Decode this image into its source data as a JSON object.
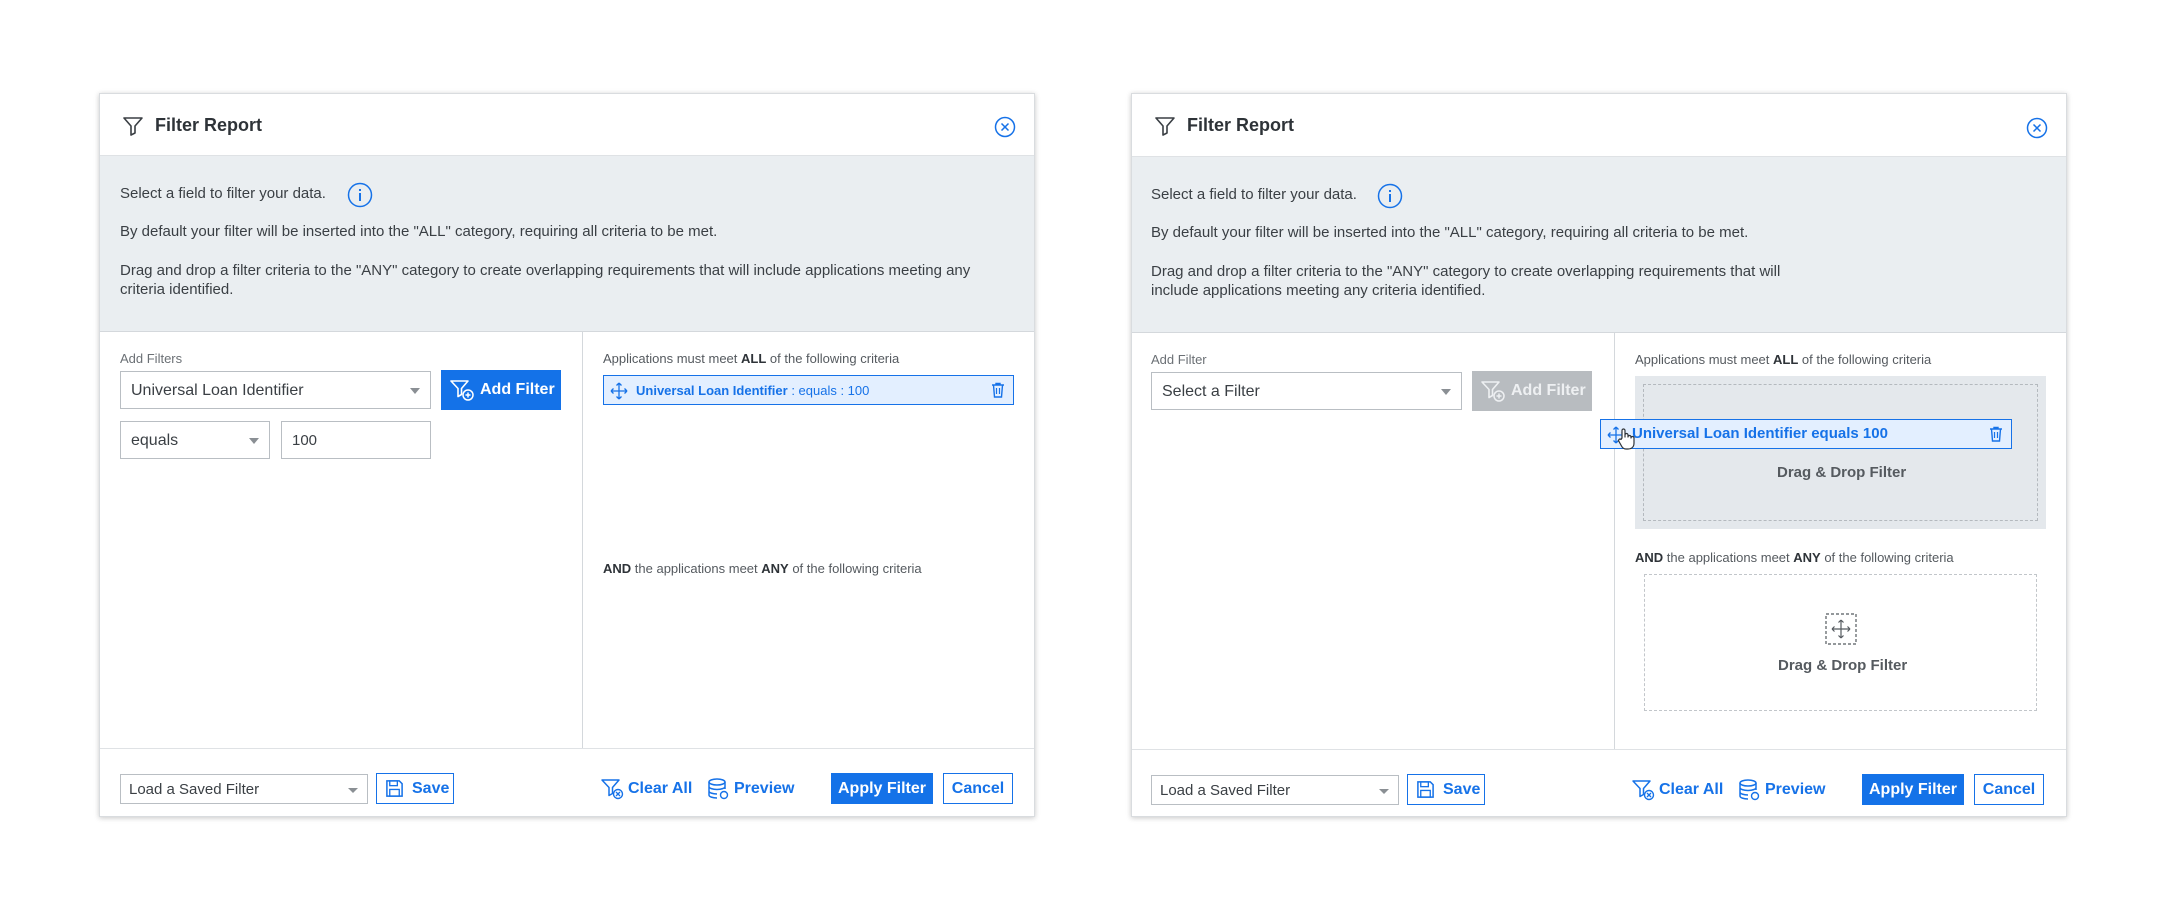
{
  "dialogs": [
    {
      "title": "Filter Report",
      "info": {
        "line1": "Select a field to filter your data.",
        "line2": "By default your filter will be inserted into the \"ALL\" category, requiring all criteria to be met.",
        "line3a": "Drag and drop a filter criteria to the \"ANY\" category to create overlapping requirements that will include applications meeting any",
        "line3b": "criteria identified."
      },
      "left": {
        "label": "Add Filters",
        "field_select": "Universal Loan Identifier",
        "add_button": "Add Filter",
        "operator_select": "equals",
        "value_input": "100"
      },
      "right": {
        "all_pre": "Applications must meet ",
        "all_bold": "ALL",
        "all_post": " of the following criteria",
        "chip_field": "Universal Loan Identifier",
        "chip_rest": " : equals : 100",
        "any_bold1": "AND",
        "any_mid": " the applications meet ",
        "any_bold2": "ANY",
        "any_post": " of the following criteria"
      },
      "footer": {
        "saved_filter": "Load a Saved Filter",
        "save": "Save",
        "clear_all": "Clear All",
        "preview": "Preview",
        "apply": "Apply Filter",
        "cancel": "Cancel"
      }
    },
    {
      "title": "Filter Report",
      "info": {
        "line1": "Select a field to filter your data.",
        "line2": "By default your filter will be inserted into the \"ALL\" category, requiring all criteria to be met.",
        "line3a": "Drag and drop a filter criteria to the \"ANY\" category to create overlapping requirements that will",
        "line3b": "include applications meeting any criteria identified."
      },
      "left": {
        "label": "Add Filter",
        "field_select": "Select a Filter",
        "add_button": "Add Filter"
      },
      "right": {
        "all_pre": "Applications must meet ",
        "all_bold": "ALL",
        "all_post": " of the following criteria",
        "drag_chip": "Universal Loan Identifier equals 100",
        "dropzone_all": "Drag & Drop Filter",
        "any_bold1": "AND",
        "any_mid": " the applications meet ",
        "any_bold2": "ANY",
        "any_post": " of the following criteria",
        "dropzone_any": "Drag & Drop Filter"
      },
      "footer": {
        "saved_filter": "Load a Saved Filter",
        "save": "Save",
        "clear_all": "Clear All",
        "preview": "Preview",
        "apply": "Apply Filter",
        "cancel": "Cancel"
      }
    }
  ],
  "colors": {
    "accent": "#1472e8",
    "info_bg": "#eaeef1",
    "chip_bg": "#e3efff",
    "disabled": "#b8bcc0"
  }
}
